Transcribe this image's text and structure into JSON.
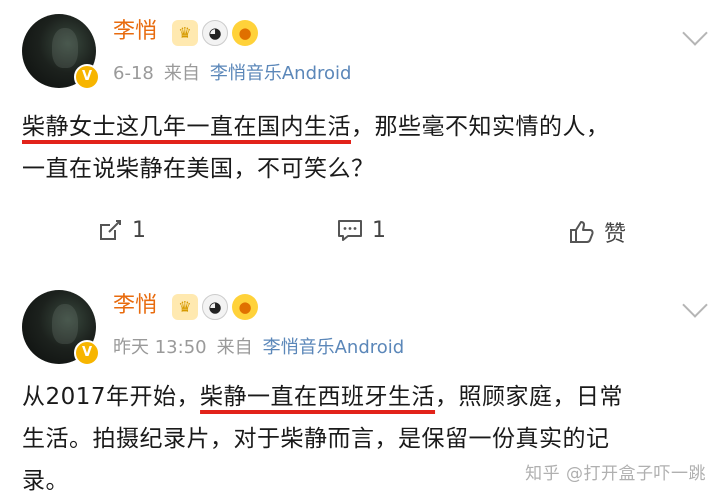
{
  "posts": [
    {
      "username": "李悄",
      "date": "6-18",
      "source_prefix": "来自",
      "source": "李悄音乐Android",
      "text": {
        "highlight": "柴静女士这几年一直在国内生活",
        "line1_rest": "，那些毫不知实情的人，",
        "line2": "一直在说柴静在美国，不可笑么？"
      },
      "actions": {
        "share_count": "1",
        "comment_count": "1",
        "like_label": "赞"
      }
    },
    {
      "username": "李悄",
      "date": "昨天 13:50",
      "source_prefix": "来自",
      "source": "李悄音乐Android",
      "text": {
        "line1_pre": "从2017年开始，",
        "highlight": "柴静一直在西班牙生活",
        "line1_rest": "，照顾家庭，日常",
        "line2": "生活。拍摄纪录片，对于柴静而言，是保留一份真实的记",
        "line3": "录。"
      }
    }
  ],
  "watermark": "知乎 @打开盒子吓一跳",
  "badge_icons": [
    "crown-badge-icon",
    "panda-badge-icon",
    "fish-badge-icon"
  ],
  "colors": {
    "username": "#e86b0e",
    "source_link": "#5b87b9",
    "underline": "#e2231a",
    "verified": "#f7b500"
  }
}
